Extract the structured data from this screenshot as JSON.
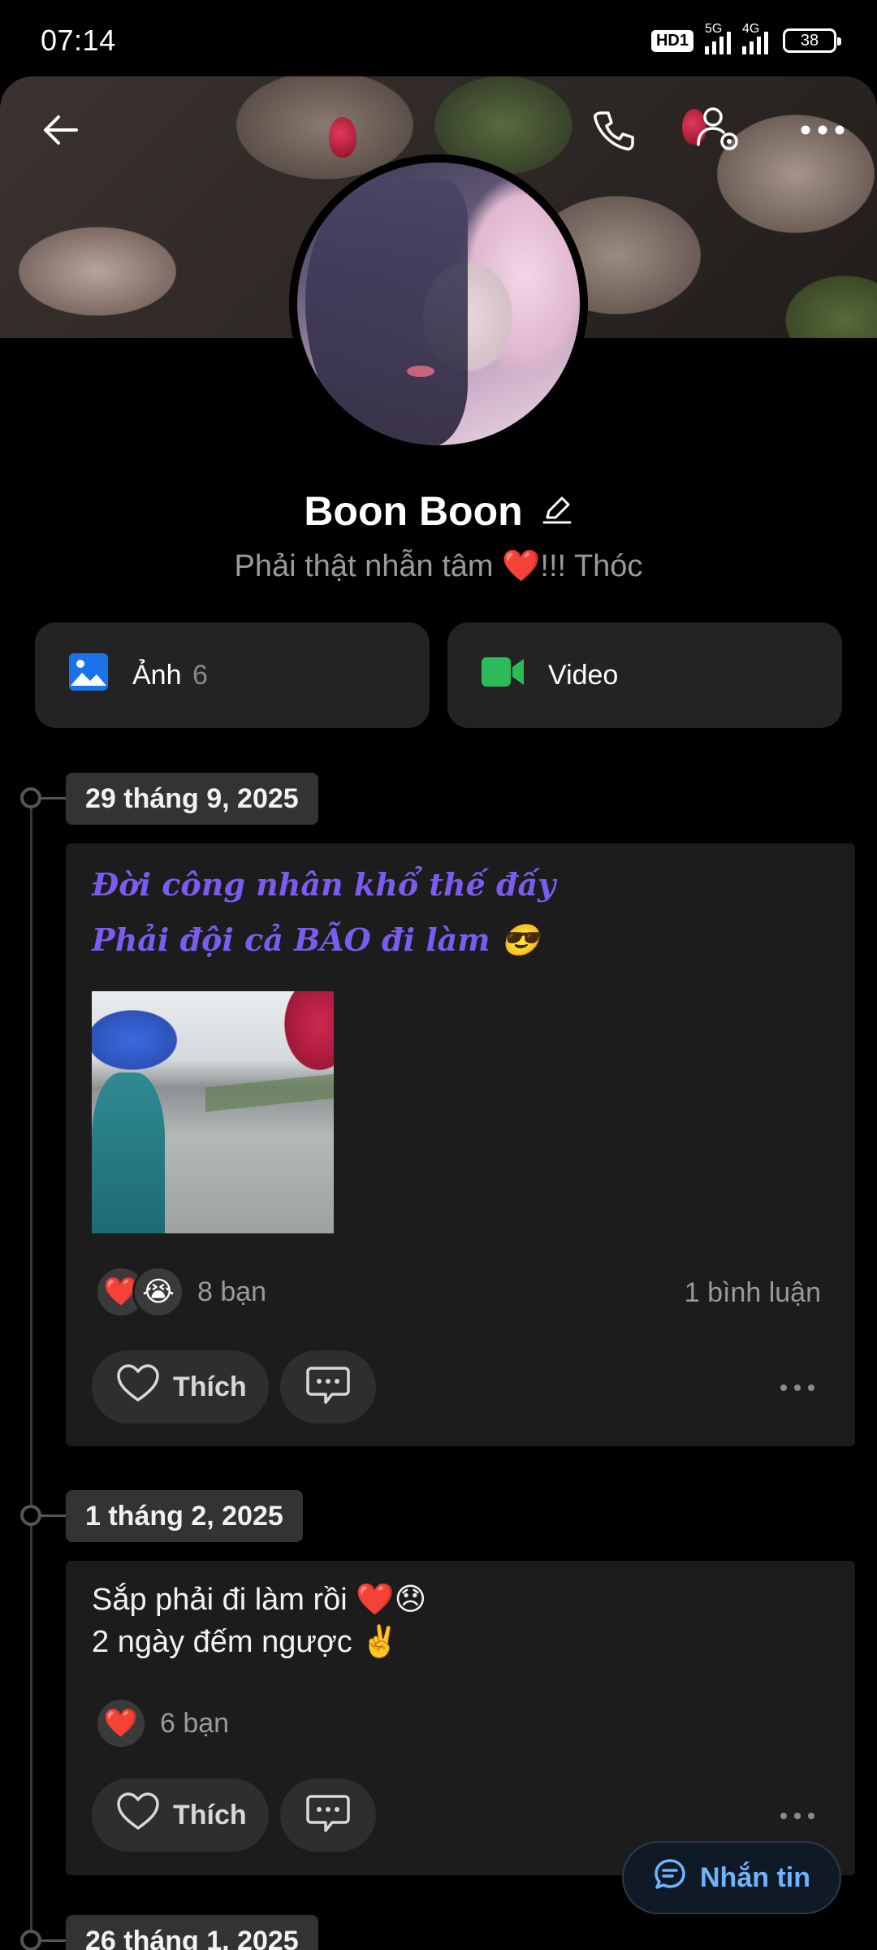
{
  "status_bar": {
    "time": "07:14",
    "hd_label": "HD1",
    "net1": "5G",
    "net2": "4G",
    "battery": "38"
  },
  "profile": {
    "name": "Boon Boon",
    "bio": "Phải thật nhẫn tâm ❤️!!! Thóc"
  },
  "media": {
    "photos_label": "Ảnh",
    "photos_count": "6",
    "videos_label": "Video"
  },
  "posts": [
    {
      "date": "29 tháng 9, 2025",
      "line1": "Đời công nhân khổ thế đấy",
      "line2": "Phải đội cả BÃO đi làm 😎",
      "reaction1": "❤️",
      "reaction2": "😭",
      "reaction_count": "8 bạn",
      "comment_count": "1 bình luận",
      "like_label": "Thích"
    },
    {
      "date": "1 tháng 2, 2025",
      "line1": "Sắp phải đi làm rồi ❤️😞",
      "line2": "2 ngày đếm ngược ✌️",
      "reaction1": "❤️",
      "reaction_count": "6 bạn",
      "like_label": "Thích"
    },
    {
      "date": "26 tháng 1, 2025"
    }
  ],
  "fab": {
    "label": "Nhắn tin"
  },
  "colors": {
    "accent_blue": "#6fb4ff",
    "styled_text_purple": "#7a5cf0",
    "photo_icon_blue": "#1a73e8",
    "video_icon_green": "#2dbb5a"
  }
}
